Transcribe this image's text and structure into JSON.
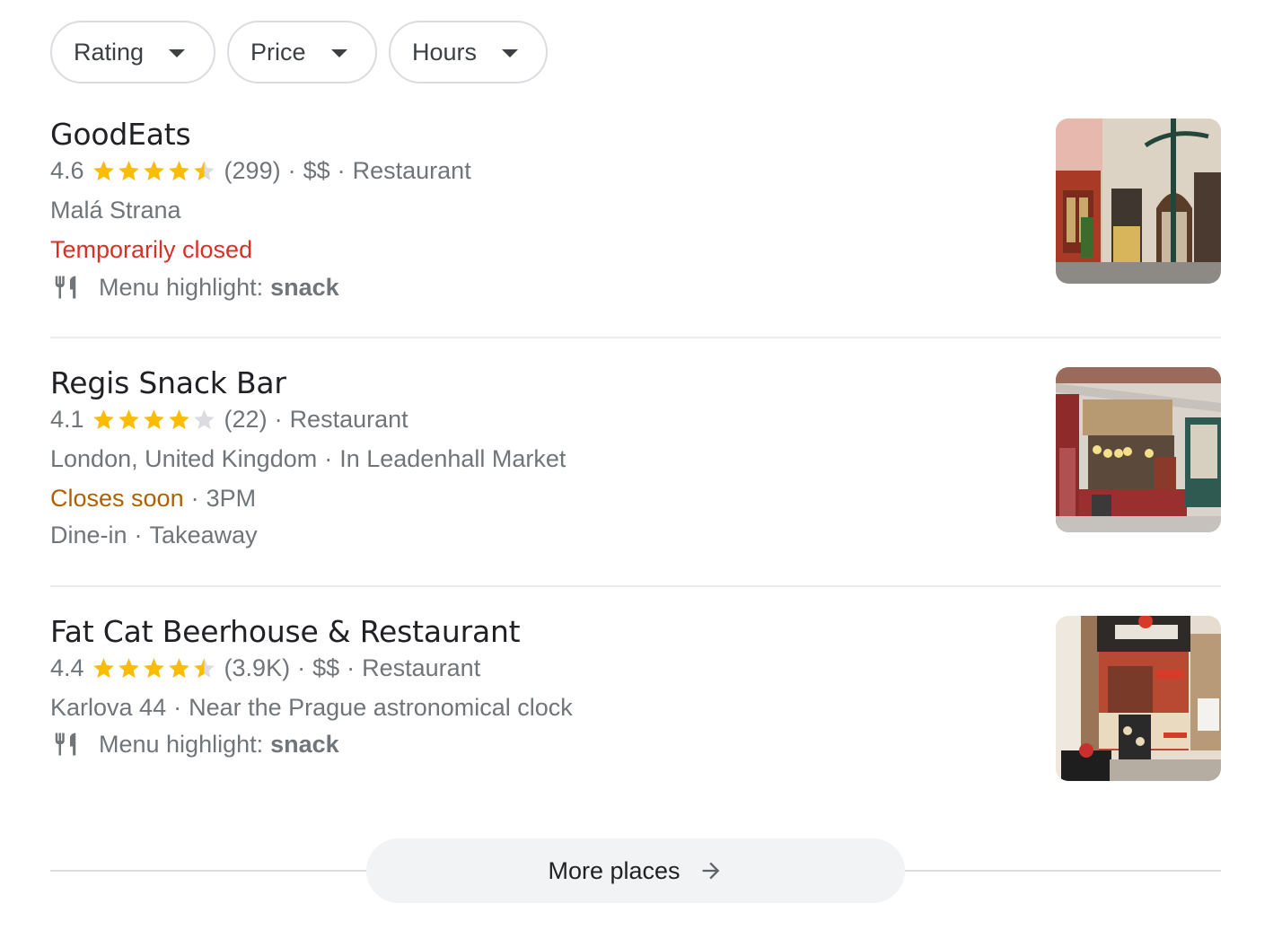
{
  "filters": [
    {
      "label": "Rating",
      "icon": "caret-down-icon"
    },
    {
      "label": "Price",
      "icon": "caret-down-icon"
    },
    {
      "label": "Hours",
      "icon": "caret-down-icon"
    }
  ],
  "places": [
    {
      "name": "GoodEats",
      "rating": "4.6",
      "rating_value": 4.6,
      "reviews": "(299)",
      "price": "$$",
      "category": "Restaurant",
      "location": "Malá Strana",
      "status": "Temporarily closed",
      "status_color": "#d93025",
      "menu_prefix": "Menu highlight:",
      "menu_item": "snack",
      "image": "storefront-photo-goodeats"
    },
    {
      "name": "Regis Snack Bar",
      "rating": "4.1",
      "rating_value": 4.1,
      "reviews": "(22)",
      "category": "Restaurant",
      "location": "London, United Kingdom",
      "location_detail": "In Leadenhall Market",
      "status": "Closes soon",
      "status_color": "#b06000",
      "hours": "3PM",
      "services": [
        "Dine-in",
        "Takeaway"
      ],
      "image": "storefront-photo-regis"
    },
    {
      "name": "Fat Cat Beerhouse & Restaurant",
      "rating": "4.4",
      "rating_value": 4.4,
      "reviews": "(3.9K)",
      "price": "$$",
      "category": "Restaurant",
      "location": "Karlova 44",
      "location_detail": "Near the Prague astronomical clock",
      "menu_prefix": "Menu highlight:",
      "menu_item": "snack",
      "image": "storefront-photo-fatcat"
    }
  ],
  "separator": "·",
  "more_places": {
    "label": "More places",
    "icon": "arrow-right-icon"
  },
  "colors": {
    "star": "#fbbc04",
    "star_empty": "#dadce0",
    "text_secondary": "#70757a"
  }
}
